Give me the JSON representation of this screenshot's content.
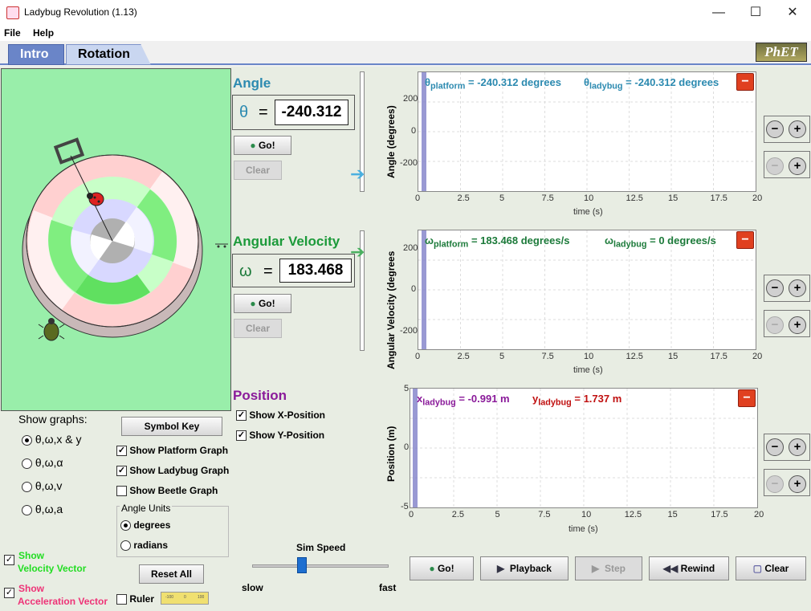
{
  "window": {
    "title": "Ladybug Revolution (1.13)"
  },
  "menu": {
    "file": "File",
    "help": "Help"
  },
  "tabs": [
    {
      "label": "Intro"
    },
    {
      "label": "Rotation"
    }
  ],
  "logo": "PhET",
  "angle": {
    "title": "Angle",
    "symbol": "θ",
    "eq": "=",
    "value": "-240.312",
    "go": "Go!",
    "clear": "Clear",
    "ylabel": "Angle (degrees)",
    "readout1_sym": "θ",
    "readout1_sub": "platform",
    "readout1_val": "= -240.312 degrees",
    "readout2_sym": "θ",
    "readout2_sub": "ladybug",
    "readout2_val": "= -240.312 degrees",
    "yticks": [
      "200",
      "0",
      "-200"
    ]
  },
  "velocity": {
    "title": "Angular Velocity",
    "symbol": "ω",
    "eq": "=",
    "value": "183.468",
    "go": "Go!",
    "clear": "Clear",
    "ylabel": "Angular Velocity (degrees",
    "readout1_sym": "ω",
    "readout1_sub": "platform",
    "readout1_val": "= 183.468 degrees/s",
    "readout2_sym": "ω",
    "readout2_sub": "ladybug",
    "readout2_val": "= 0 degrees/s",
    "yticks": [
      "200",
      "0",
      "-200"
    ]
  },
  "position": {
    "title": "Position",
    "show_x": "Show X-Position",
    "show_y": "Show Y-Position",
    "ylabel": "Position (m)",
    "readout1_sym": "x",
    "readout1_sub": "ladybug",
    "readout1_val": "= -0.991 m",
    "readout2_sym": "y",
    "readout2_sub": "ladybug",
    "readout2_val": "= 1.737 m",
    "yticks": [
      "5",
      "0",
      "-5"
    ]
  },
  "xticks": [
    "0",
    "2.5",
    "5",
    "7.5",
    "10",
    "12.5",
    "15",
    "17.5",
    "20"
  ],
  "xlabel": "time (s)",
  "show_graphs": {
    "title": "Show graphs:",
    "options": [
      "θ,ω,x & y",
      "θ,ω,α",
      "θ,ω,v",
      "θ,ω,a"
    ]
  },
  "symbol_key": "Symbol Key",
  "graph_checks": [
    "Show Platform Graph",
    "Show Ladybug Graph",
    "Show Beetle Graph"
  ],
  "angle_units": {
    "title": "Angle Units",
    "degrees": "degrees",
    "radians": "radians"
  },
  "reset_all": "Reset All",
  "ruler": "Ruler",
  "ruler_ticks": [
    "-100",
    "0",
    "100"
  ],
  "velocity_vector": {
    "show": "Show",
    "label": "Velocity Vector"
  },
  "accel_vector": {
    "show": "Show",
    "label": "Acceleration Vector"
  },
  "sim_speed": {
    "title": "Sim Speed",
    "slow": "slow",
    "fast": "fast",
    "value": 0.33
  },
  "bottom": {
    "go": "Go!",
    "playback": "Playback",
    "step": "Step",
    "rewind": "Rewind",
    "clear": "Clear"
  },
  "colors": {
    "green_play": "#99eeaa",
    "angle_blue": "#2c8ab0",
    "vel_green": "#1c7a3a",
    "pos_purple": "#8a1a9a",
    "pos_red": "#c01010",
    "vel_vec": "#22dd22",
    "acc_vec": "#ee3377"
  }
}
